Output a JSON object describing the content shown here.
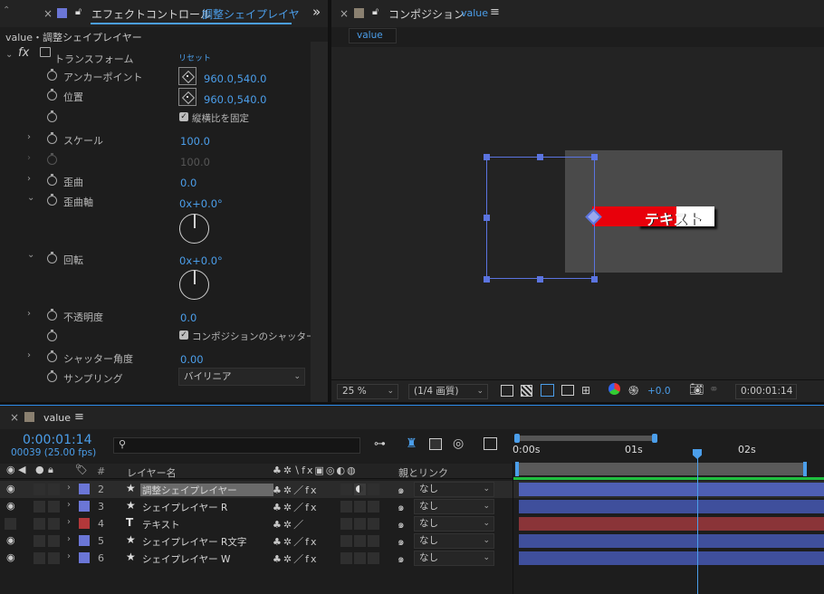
{
  "effects_panel": {
    "close": "×",
    "title_prefix": "エフェクトコントロール",
    "title_target": "調整シェイプレイヤ",
    "expand": "»",
    "breadcrumb": "value・調整シェイプレイヤー",
    "fx_label": "fx",
    "group_name": "トランスフォーム",
    "reset": "リセット",
    "props": {
      "anchor": {
        "label": "アンカーポイント",
        "value": "960.0,540.0"
      },
      "position": {
        "label": "位置",
        "value": "960.0,540.0"
      },
      "uniform_scale": {
        "label": "縦横比を固定",
        "checked": true
      },
      "scale": {
        "label": "スケール",
        "value": "100.0"
      },
      "scale_dim": {
        "value": "100.0"
      },
      "skew": {
        "label": "歪曲",
        "value": "0.0"
      },
      "skew_axis": {
        "label": "歪曲軸",
        "value": "0x+0.0°"
      },
      "rotation": {
        "label": "回転",
        "value": "0x+0.0°"
      },
      "opacity": {
        "label": "不透明度",
        "value": "0.0"
      },
      "comp_shutter": {
        "label": "コンポジションのシャッター",
        "checked": true
      },
      "shutter_angle": {
        "label": "シャッター角度",
        "value": "0.00"
      },
      "sampling": {
        "label": "サンプリング",
        "value": "バイリニア"
      }
    }
  },
  "comp_panel": {
    "close": "×",
    "title": "コンポジション",
    "comp_name": "value",
    "menu": "≡",
    "tab": "value",
    "canvas_text": "テキスト",
    "toolbar": {
      "zoom": "25 %",
      "resolution": "(1/4 画質)",
      "exposure": "+0.0",
      "timecode": "0:00:01:14"
    }
  },
  "timeline": {
    "close": "×",
    "name": "value",
    "menu": "≡",
    "timecode": "0:00:01:14",
    "frames": "00039 (25.00 fps)",
    "search_placeholder": "",
    "ruler": [
      "0:00s",
      "01s",
      "02s"
    ],
    "headers": {
      "hash": "#",
      "layer_name": "レイヤー名",
      "parent": "親とリンク"
    },
    "layers": [
      {
        "num": "2",
        "icon": "★",
        "name": "調整シェイプレイヤー",
        "color": "#6b76d6",
        "parent": "なし",
        "visible": true,
        "selected": true,
        "fx": true,
        "adj": true,
        "bar": "#4e5fb4"
      },
      {
        "num": "3",
        "icon": "★",
        "name": "シェイプレイヤー R",
        "color": "#6b76d6",
        "parent": "なし",
        "visible": true,
        "selected": false,
        "fx": true,
        "adj": false,
        "bar": "#3f4f9c"
      },
      {
        "num": "4",
        "icon": "T",
        "name": "テキスト",
        "color": "#b3383a",
        "parent": "なし",
        "visible": false,
        "selected": false,
        "fx": false,
        "adj": false,
        "bar": "#8a3438"
      },
      {
        "num": "5",
        "icon": "★",
        "name": "シェイプレイヤー R文字",
        "color": "#6b76d6",
        "parent": "なし",
        "visible": true,
        "selected": false,
        "fx": true,
        "adj": false,
        "bar": "#3f4f9c"
      },
      {
        "num": "6",
        "icon": "★",
        "name": "シェイプレイヤー W",
        "color": "#6b76d6",
        "parent": "なし",
        "visible": true,
        "selected": false,
        "fx": true,
        "adj": false,
        "bar": "#3f4f9c"
      }
    ]
  }
}
